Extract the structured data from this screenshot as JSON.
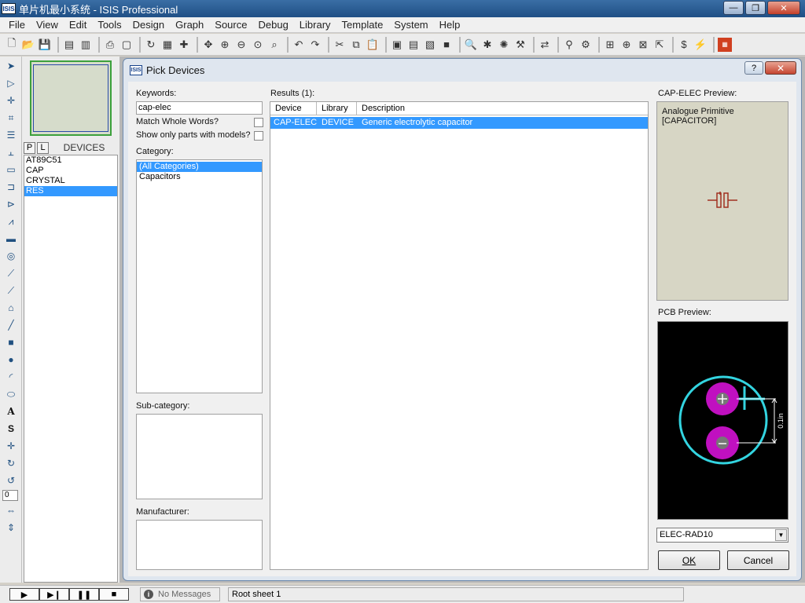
{
  "window": {
    "title": "单片机最小系统 - ISIS Professional",
    "logo": "ISIS"
  },
  "menu": [
    "File",
    "View",
    "Edit",
    "Tools",
    "Design",
    "Graph",
    "Source",
    "Debug",
    "Library",
    "Template",
    "System",
    "Help"
  ],
  "devices_panel": {
    "p_label": "P",
    "l_label": "L",
    "header": "DEVICES",
    "items": [
      "AT89C51",
      "CAP",
      "CRYSTAL",
      "RES"
    ],
    "selected": "RES"
  },
  "rotation_value": "0",
  "dialog": {
    "title": "Pick Devices",
    "logo": "ISIS",
    "help_label": "?",
    "close_label": "✕",
    "keywords_label": "Keywords:",
    "keywords_value": "cap-elec",
    "match_whole_words_label": "Match Whole Words?",
    "show_models_label": "Show only parts with models?",
    "category_label": "Category:",
    "categories": [
      "(All Categories)",
      "Capacitors"
    ],
    "subcategory_label": "Sub-category:",
    "manufacturer_label": "Manufacturer:",
    "results_label": "Results (1):",
    "columns": [
      "Device",
      "Library",
      "Description"
    ],
    "results": [
      {
        "device": "CAP-ELEC",
        "library": "DEVICE",
        "description": "Generic electrolytic capacitor"
      }
    ],
    "preview_label": "CAP-ELEC Preview:",
    "preview_text": "Analogue Primitive [CAPACITOR]",
    "pcb_label": "PCB Preview:",
    "pcb_dimension": "0.1in",
    "package": "ELEC-RAD10",
    "ok_label": "OK",
    "cancel_label": "Cancel"
  },
  "status": {
    "messages": "No Messages",
    "sheet": "Root sheet 1"
  },
  "colors": {
    "selection": "#3399ff",
    "pcb_outline": "#33d4e0",
    "pcb_pad": "#c010c0",
    "schematic_symbol": "#a03020"
  }
}
